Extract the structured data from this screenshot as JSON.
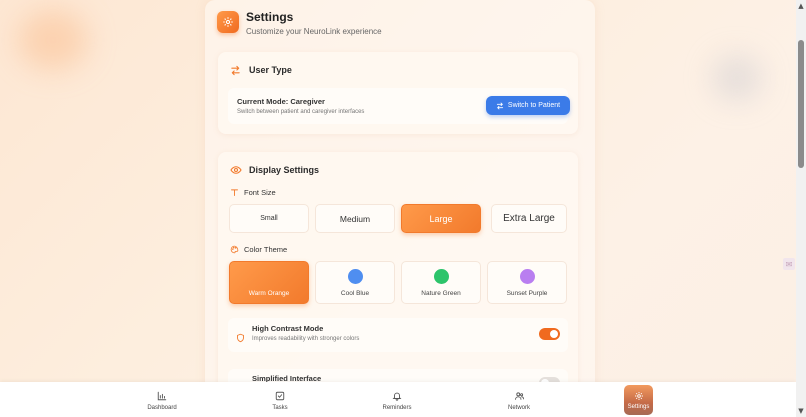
{
  "header": {
    "title": "Settings",
    "subtitle": "Customize your NeuroLink experience"
  },
  "user_type": {
    "title": "User Type",
    "current_mode": "Current Mode: Caregiver",
    "description": "Switch between patient and caregiver interfaces",
    "switch_label": "Switch to Patient"
  },
  "display": {
    "title": "Display Settings",
    "font_size_label": "Font Size",
    "font_sizes": [
      {
        "label": "Small",
        "selected": false
      },
      {
        "label": "Medium",
        "selected": false
      },
      {
        "label": "Large",
        "selected": true
      },
      {
        "label": "Extra Large",
        "selected": false
      }
    ],
    "color_theme_label": "Color Theme",
    "themes": [
      {
        "label": "Warm Orange",
        "color": "#f97f2f",
        "selected": true
      },
      {
        "label": "Cool Blue",
        "color": "#4f8ef0",
        "selected": false
      },
      {
        "label": "Nature Green",
        "color": "#2dc46b",
        "selected": false
      },
      {
        "label": "Sunset Purple",
        "color": "#b97ef0",
        "selected": false
      }
    ],
    "high_contrast": {
      "title": "High Contrast Mode",
      "description": "Improves readability with stronger colors",
      "enabled": true
    },
    "simplified": {
      "title": "Simplified Interface",
      "enabled": false
    }
  },
  "nav": {
    "items": [
      {
        "label": "Dashboard",
        "icon": "chart-icon"
      },
      {
        "label": "Tasks",
        "icon": "checkbox-icon"
      },
      {
        "label": "Reminders",
        "icon": "bell-icon"
      },
      {
        "label": "Network",
        "icon": "users-icon"
      },
      {
        "label": "Settings",
        "icon": "gear-icon",
        "active": true
      }
    ]
  },
  "colors": {
    "accent": "#f27a2c",
    "primary_button": "#3b7be8"
  }
}
